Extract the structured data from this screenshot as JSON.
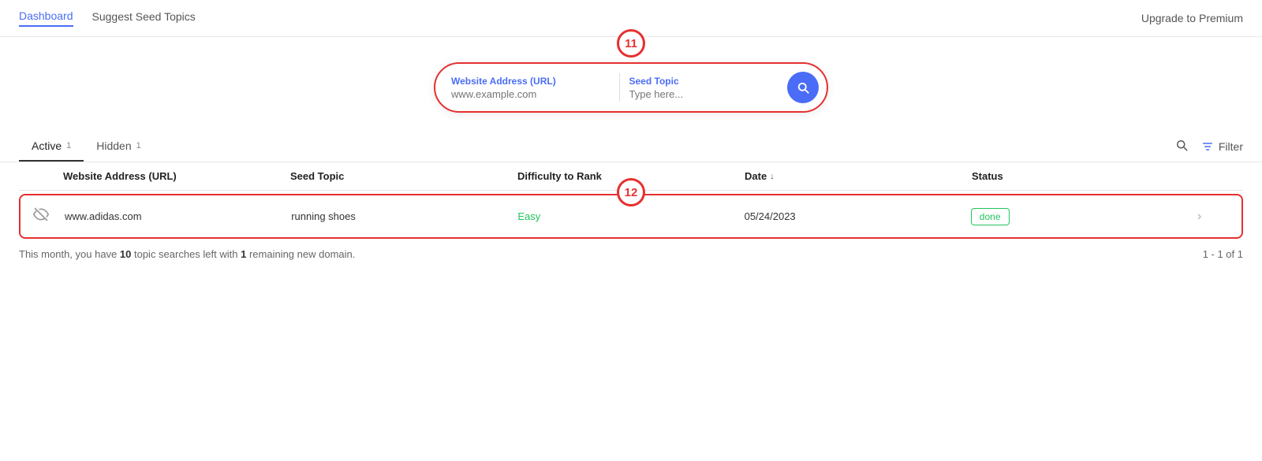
{
  "nav": {
    "items": [
      {
        "label": "Dashboard",
        "active": true
      },
      {
        "label": "Suggest Seed Topics",
        "active": false
      }
    ],
    "upgrade_label": "Upgrade to Premium"
  },
  "search_bar": {
    "annotation": "11",
    "url_field": {
      "label": "Website Address (URL)",
      "placeholder": "www.example.com"
    },
    "topic_field": {
      "label": "Seed Topic",
      "placeholder": "Type here..."
    },
    "search_button_icon": "search-icon"
  },
  "tabs": {
    "items": [
      {
        "label": "Active",
        "count": "1",
        "active": true
      },
      {
        "label": "Hidden",
        "count": "1",
        "active": false
      }
    ],
    "filter_label": "Filter"
  },
  "table": {
    "annotation": "12",
    "headers": [
      {
        "label": ""
      },
      {
        "label": "Website Address (URL)"
      },
      {
        "label": "Seed Topic"
      },
      {
        "label": "Difficulty to Rank"
      },
      {
        "label": "Date",
        "sortable": true,
        "sort_dir": "↓"
      },
      {
        "label": "Status"
      },
      {
        "label": ""
      }
    ],
    "rows": [
      {
        "hidden_icon": true,
        "url": "www.adidas.com",
        "seed_topic": "running shoes",
        "difficulty": "Easy",
        "difficulty_type": "easy",
        "date": "05/24/2023",
        "status": "done",
        "status_type": "done"
      }
    ]
  },
  "footer": {
    "text_prefix": "This month, you have ",
    "searches_left": "10",
    "text_mid": " topic searches left with ",
    "domains_left": "1",
    "text_suffix": " remaining new domain.",
    "pagination": "1 - 1 of 1"
  }
}
